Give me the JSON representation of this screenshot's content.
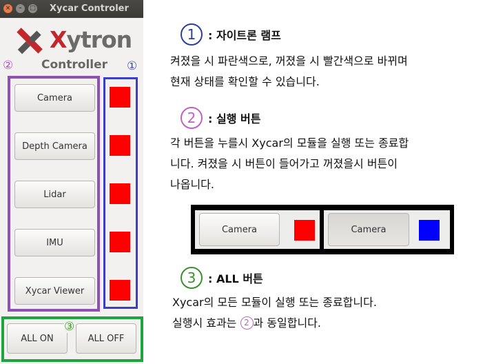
{
  "window": {
    "title": "Xycar Controler",
    "close_glyph": "×",
    "min_glyph": "–",
    "max_glyph": "□"
  },
  "brand": {
    "x_letter": "X",
    "rest": "ytron",
    "subtitle": "Controller"
  },
  "markers": {
    "one": "①",
    "two": "②",
    "three": "③"
  },
  "modules": [
    {
      "label": "Camera",
      "lamp_color": "#ff0000"
    },
    {
      "label": "Depth Camera",
      "lamp_color": "#ff0000"
    },
    {
      "label": "Lidar",
      "lamp_color": "#ff0000"
    },
    {
      "label": "IMU",
      "lamp_color": "#ff0000"
    },
    {
      "label": "Xycar Viewer",
      "lamp_color": "#ff0000"
    }
  ],
  "all_buttons": {
    "on": "ALL ON",
    "off": "ALL OFF"
  },
  "section1": {
    "num": "1",
    "title": ": 자이트론 램프",
    "line1": "켜졌을 시 파란색으로, 꺼졌을 시 빨간색으로 바뀌며",
    "line2": "현재 상태를 확인할 수 있습니다."
  },
  "section2": {
    "num": "2",
    "title": ": 실행 버튼",
    "line1": "각 버튼을 누를시 Xycar의 모듈을 실행 또는 종료합",
    "line2": "니다. 켜졌을 시 버튼이 들어가고 꺼졌을시 버튼이",
    "line3": "나옵니다."
  },
  "demo": {
    "off_label": "Camera",
    "on_label": "Camera",
    "off_color": "#ff0000",
    "on_color": "#0000ff"
  },
  "section3": {
    "num": "3",
    "title": ": ALL 버튼",
    "line1": "Xycar의 모든 모듈이 실행 또는 종료합니다.",
    "line2_pre": "실행시 효과는 ",
    "line2_num": "2",
    "line2_post": "과 동일합니다."
  }
}
